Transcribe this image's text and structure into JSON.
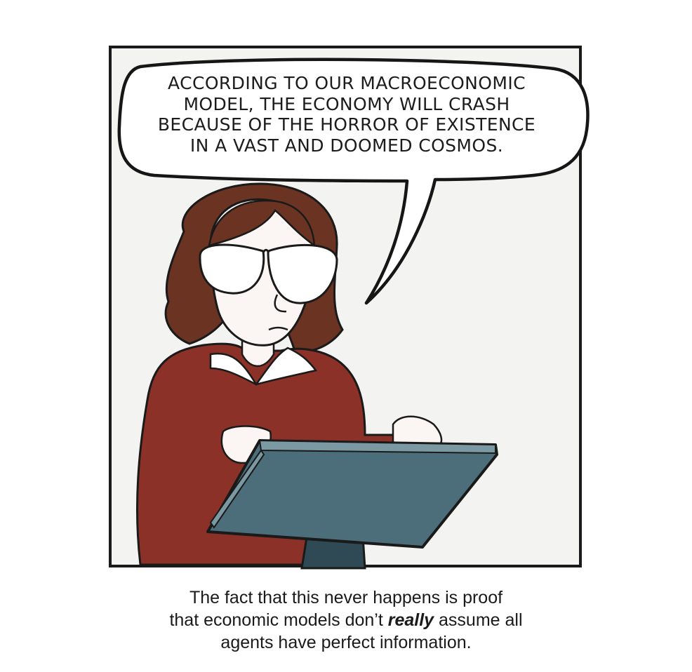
{
  "speech_bubble": {
    "lines": [
      "ACCORDING TO OUR MACROECONOMIC",
      "MODEL, THE ECONOMY WILL CRASH",
      "BECAUSE OF THE HORROR OF EXISTENCE",
      "IN A VAST AND DOOMED COSMOS."
    ]
  },
  "caption": {
    "before": "The fact that this never happens is proof",
    "line2_start": "that economic models don’t ",
    "emphasis": "really",
    "line2_end": " assume all",
    "line3": "agents have perfect information."
  },
  "colors": {
    "sweater": "#8b3127",
    "hair": "#6b3322",
    "monitor": "#4b6e7a",
    "skin": "#fbf6f3"
  },
  "icons": [
    "comic-panel",
    "woman-character",
    "glasses-icon",
    "computer-monitor",
    "speech-bubble"
  ]
}
